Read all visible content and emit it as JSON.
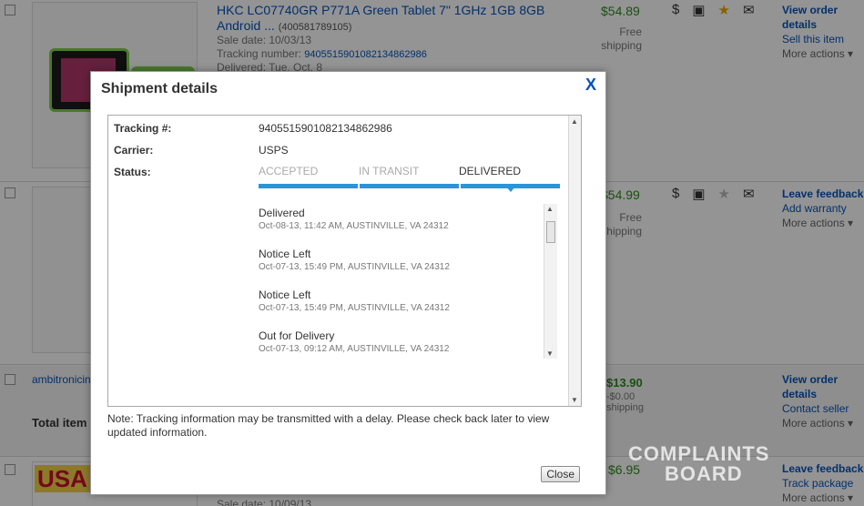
{
  "background": {
    "row1": {
      "title": "HKC LC07740GR P771A Green Tablet 7\" 1GHz 1GB 8GB Android ...",
      "item_number": "(400581789105)",
      "sale_date": "Sale date: 10/03/13",
      "tracking_label": "Tracking number:",
      "tracking_number": "9405515901082134862986",
      "delivered": "Delivered: Tue, Oct. 8",
      "price": "$54.89",
      "shipping": "Free shipping",
      "actions": [
        "View order details",
        "Sell this item",
        "More actions"
      ]
    },
    "row2": {
      "price": "$54.99",
      "shipping": "Free shipping",
      "actions": [
        "Leave feedback",
        "Add warranty",
        "More actions"
      ]
    },
    "row3": {
      "seller": "ambitronicin",
      "total_label": "Total item",
      "price": "$13.90",
      "discount": "-$0.00",
      "shipping": "shipping",
      "actions": [
        "View order details",
        "Contact seller",
        "More actions"
      ]
    },
    "row4": {
      "sale_date": "Sale date: 10/09/13",
      "price": "$6.95",
      "actions": [
        "Leave feedback",
        "Track package",
        "More actions"
      ]
    }
  },
  "modal": {
    "title": "Shipment details",
    "close_x": "X",
    "tracking_label": "Tracking #:",
    "tracking_value": "9405515901082134862986",
    "carrier_label": "Carrier:",
    "carrier_value": "USPS",
    "status_label": "Status:",
    "steps": [
      "ACCEPTED",
      "IN TRANSIT",
      "DELIVERED"
    ],
    "active_step": "DELIVERED",
    "progress_fraction": 1.0,
    "events": [
      {
        "status": "Delivered",
        "detail": "Oct-08-13, 11:42 AM, AUSTINVILLE, VA 24312"
      },
      {
        "status": "Notice Left",
        "detail": "Oct-07-13, 15:49 PM, AUSTINVILLE, VA 24312"
      },
      {
        "status": "Notice Left",
        "detail": "Oct-07-13, 15:49 PM, AUSTINVILLE, VA 24312"
      },
      {
        "status": "Out for Delivery",
        "detail": "Oct-07-13, 09:12 AM, AUSTINVILLE, VA 24312"
      }
    ],
    "note": "Note: Tracking information may be transmitted with a delay. Please check back later to view updated information.",
    "close_button": "Close"
  },
  "watermark": {
    "line1": "COMPLAINTS",
    "line2": "BOARD"
  },
  "colors": {
    "accent": "#2b95d6",
    "link": "#0654ba",
    "price": "#2d8a1f"
  }
}
